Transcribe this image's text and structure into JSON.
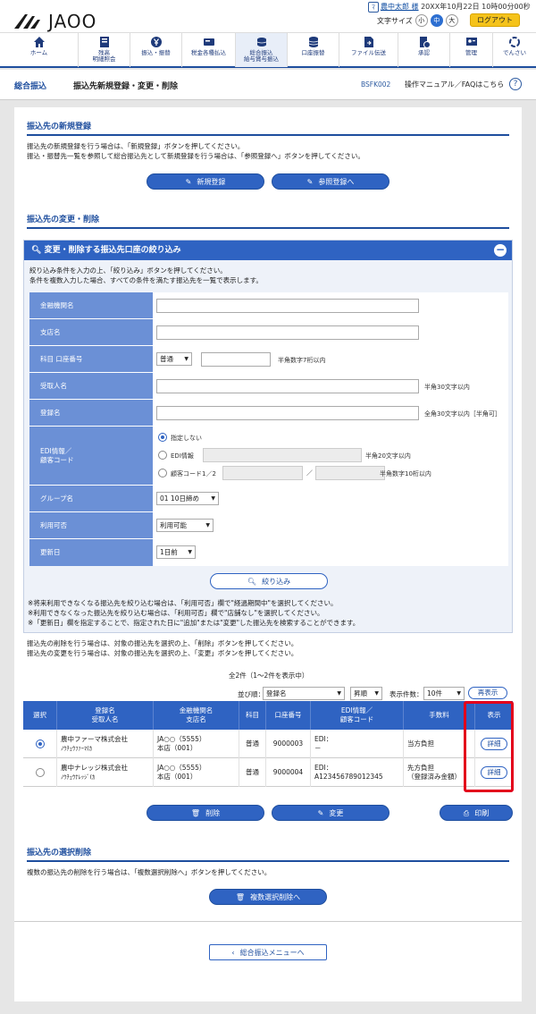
{
  "header": {
    "logo": "JAOO",
    "user_name": "農中太郎 様",
    "datetime": "20XX年10月22日 10時00分00秒",
    "font_size_label": "文字サイズ",
    "font_sizes": [
      "小",
      "中",
      "大"
    ],
    "logout": "ログアウト",
    "nav": [
      {
        "label": "ホーム",
        "icon": "home-icon"
      },
      {
        "label": "残高\n明細照会",
        "icon": "passbook-icon"
      },
      {
        "label": "振込・振替",
        "icon": "yen-transfer-icon"
      },
      {
        "label": "税金各種払込",
        "icon": "payment-icon"
      },
      {
        "label": "総合振込\n給与賞与振込",
        "icon": "coins-icon"
      },
      {
        "label": "口座振替",
        "icon": "coins-stack-icon"
      },
      {
        "label": "ファイル伝送",
        "icon": "file-transfer-icon"
      },
      {
        "label": "承認",
        "icon": "approval-icon"
      },
      {
        "label": "管理",
        "icon": "admin-icon"
      },
      {
        "label": "でんさい",
        "icon": "densai-icon"
      }
    ]
  },
  "titlebar": {
    "main": "総合振込",
    "sub": "振込先新規登録・変更・削除",
    "code": "BSFK002",
    "help": "操作マニュアル／FAQはこちら"
  },
  "new_section": {
    "heading": "振込先の新規登録",
    "text1": "振込先の新規登録を行う場合は、「新規登録」ボタンを押してください。",
    "text2": "振込・振替先一覧を参照して総合振込先として新規登録を行う場合は、「参照登録へ」ボタンを押してください。",
    "btn_new": "新規登録",
    "btn_ref": "参照登録へ"
  },
  "change_section": {
    "heading": "振込先の変更・削除",
    "filter_title": "変更・削除する振込先口座の絞り込み",
    "filter_text1": "絞り込み条件を入力の上、「絞り込み」ボタンを押してください。",
    "filter_text2": "条件を複数入力した場合、すべての条件を満たす振込先を一覧で表示します。",
    "labels": {
      "bank": "金融機関名",
      "branch": "支店名",
      "account": "科目 口座番号",
      "payee": "受取人名",
      "reg_name": "登録名",
      "edi": "EDI情報／\n顧客コード",
      "group": "グループ名",
      "usable": "利用可否",
      "updated": "更新日"
    },
    "account_type": "普通",
    "hint_account": "半角数字7桁以内",
    "hint_payee": "半角30文字以内",
    "hint_reg": "全角30文字以内［半角可］",
    "edi_options": [
      "指定しない",
      "EDI情報",
      "顧客コード1／2"
    ],
    "hint_edi": "半角20文字以内",
    "hint_cust": "半角数字10桁以内",
    "cust_sep": "／",
    "group_value": "01 10日締め",
    "usable_value": "利用可能",
    "updated_value": "1日前",
    "btn_filter": "絞り込み",
    "note1": "※将来利用できなくなる振込先を絞り込む場合は、「利用可否」欄で\"経過期間中\"を選択してください。",
    "note2": "※利用できなくなった振込先を絞り込む場合は、「利用可否」欄で\"店舗なし\"を選択してください。",
    "note3": "※「更新日」欄を指定することで、指定された日に\"追加\"または\"変更\"した振込先を検索することができます。",
    "info1": "振込先の削除を行う場合は、対象の振込先を選択の上、「削除」ボタンを押してください。",
    "info2": "振込先の変更を行う場合は、対象の振込先を選択の上、「変更」ボタンを押してください。"
  },
  "results": {
    "count": "全2件（1〜2件を表示中）",
    "sort_label": "並び順：",
    "sort_value": "登録名",
    "order_value": "昇順",
    "per_page_label": "表示件数：",
    "per_page_value": "10件",
    "redisplay": "再表示",
    "columns": [
      "選択",
      "登録名\n受取人名",
      "金融機関名\n支店名",
      "科目",
      "口座番号",
      "EDI情報／\n顧客コード",
      "手数料",
      "表示"
    ],
    "rows": [
      {
        "reg": "農中ファーマ株式会社",
        "kana": "ﾉｳﾁｭｳﾌｧｰﾏ(ｶ",
        "bank": "JA○○（5555）\n本店（001）",
        "type": "普通",
        "acct": "9000003",
        "edi": "EDI：\n－",
        "fee": "当方負担",
        "detail": "詳細",
        "selected": true
      },
      {
        "reg": "農中ナレッジ株式会社",
        "kana": "ﾉｳﾁｭｳﾅﾚｯｼﾞ(ｶ",
        "bank": "JA○○（5555）\n本店（001）",
        "type": "普通",
        "acct": "9000004",
        "edi": "EDI：\nA123456789012345",
        "fee": "先方負担\n（登録済み金額）",
        "detail": "詳細",
        "selected": false
      }
    ],
    "btn_delete": "削除",
    "btn_change": "変更",
    "btn_print": "印刷"
  },
  "bulk_section": {
    "heading": "振込先の選択削除",
    "text": "複数の振込先の削除を行う場合は、「複数選択削除へ」ボタンを押してください。",
    "btn": "複数選択削除へ"
  },
  "back_button": "総合振込メニューへ"
}
